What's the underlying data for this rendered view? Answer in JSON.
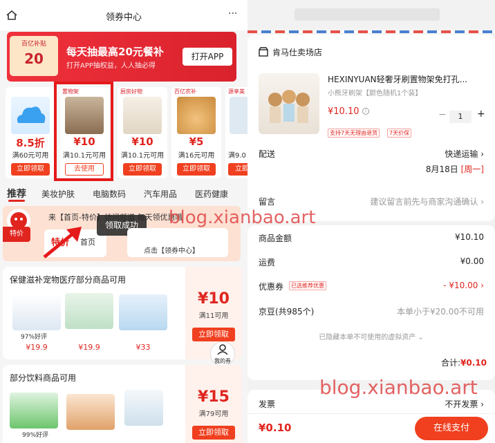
{
  "left": {
    "header": {
      "title": "领券中心"
    },
    "banner": {
      "tag_top": "百亿补贴",
      "tag_num": "20",
      "main": "每天抽最高20元餐补",
      "sub": "打开APP抽权益，人人抽必得",
      "button": "打开APP"
    },
    "cards": [
      {
        "label": "",
        "price": "8.5折",
        "cond": "满60元可用",
        "btn": "立即领取"
      },
      {
        "label": "置物架",
        "price": "¥10",
        "cond": "满10.1元可用",
        "btn": "去使用"
      },
      {
        "label": "厨房好物",
        "price": "¥10",
        "cond": "满10.1元可用",
        "btn": "立即领取"
      },
      {
        "label": "百亿农补",
        "price": "¥5",
        "cond": "满16元可用",
        "btn": "立即领取"
      },
      {
        "label": "源享美",
        "price": "",
        "cond": "满9.0",
        "btn": "立即"
      }
    ],
    "tabs": [
      "推荐",
      "美妆护肤",
      "电脑数码",
      "汽车用品",
      "医药健康"
    ],
    "promo": {
      "text": "来【首页-特价】访问频道 每天领优惠哦",
      "tab1": "特价",
      "tab2": "首页",
      "toast": "领取成功",
      "link": "点击【领券中心】",
      "badge": "特价"
    },
    "section1": {
      "title": "保健滋补宠物医疗部分商品可用",
      "rating": "97%好评",
      "prices": [
        "¥19.9",
        "¥19.9",
        "¥33"
      ],
      "coupon": "¥10",
      "cond": "满11可用",
      "btn": "立即领取",
      "my_coupon": "我的券"
    },
    "section2": {
      "title": "部分饮料商品可用",
      "rating": "99%好评",
      "coupon": "¥15",
      "cond": "满79可用",
      "btn": "立即领取"
    }
  },
  "watermark": "blog.xianbao.art",
  "right": {
    "shop": "肯马仕卖场店",
    "product": {
      "name": "HEXINYUAN轻奢牙刷置物架免打孔...",
      "spec": "小熊牙刷架【颜色随机1个装】",
      "price": "¥10.10",
      "qty": "1",
      "tag1": "支持7天无理由退货",
      "tag2": "7天价保"
    },
    "delivery": {
      "label": "配送",
      "value": "快递运输",
      "date": "8月18日",
      "weekday": "[周一]"
    },
    "message": {
      "label": "留言",
      "value": "建议留言前先与商家沟通确认"
    },
    "goods_amount": {
      "label": "商品金额",
      "value": "¥10.10"
    },
    "shipping": {
      "label": "运费",
      "value": "¥0.00"
    },
    "coupon": {
      "label": "优惠券",
      "tag": "已选推荐优惠",
      "value": "- ¥10.00"
    },
    "jd_bean": {
      "label": "京豆(共985个)",
      "value": "本单小于¥20.00不可用"
    },
    "hidden_note": "已隐藏本单不可使用的虚拟资产",
    "total": {
      "label": "合计:",
      "value": "¥0.10"
    },
    "invoice": {
      "label": "发票",
      "value": "不开发票"
    },
    "footer": {
      "price": "¥0.10",
      "pay": "在线支付"
    }
  },
  "colors": {
    "accent": "#e0251f",
    "highlight": "#e51a1a",
    "pay_button": "#f0401f"
  }
}
